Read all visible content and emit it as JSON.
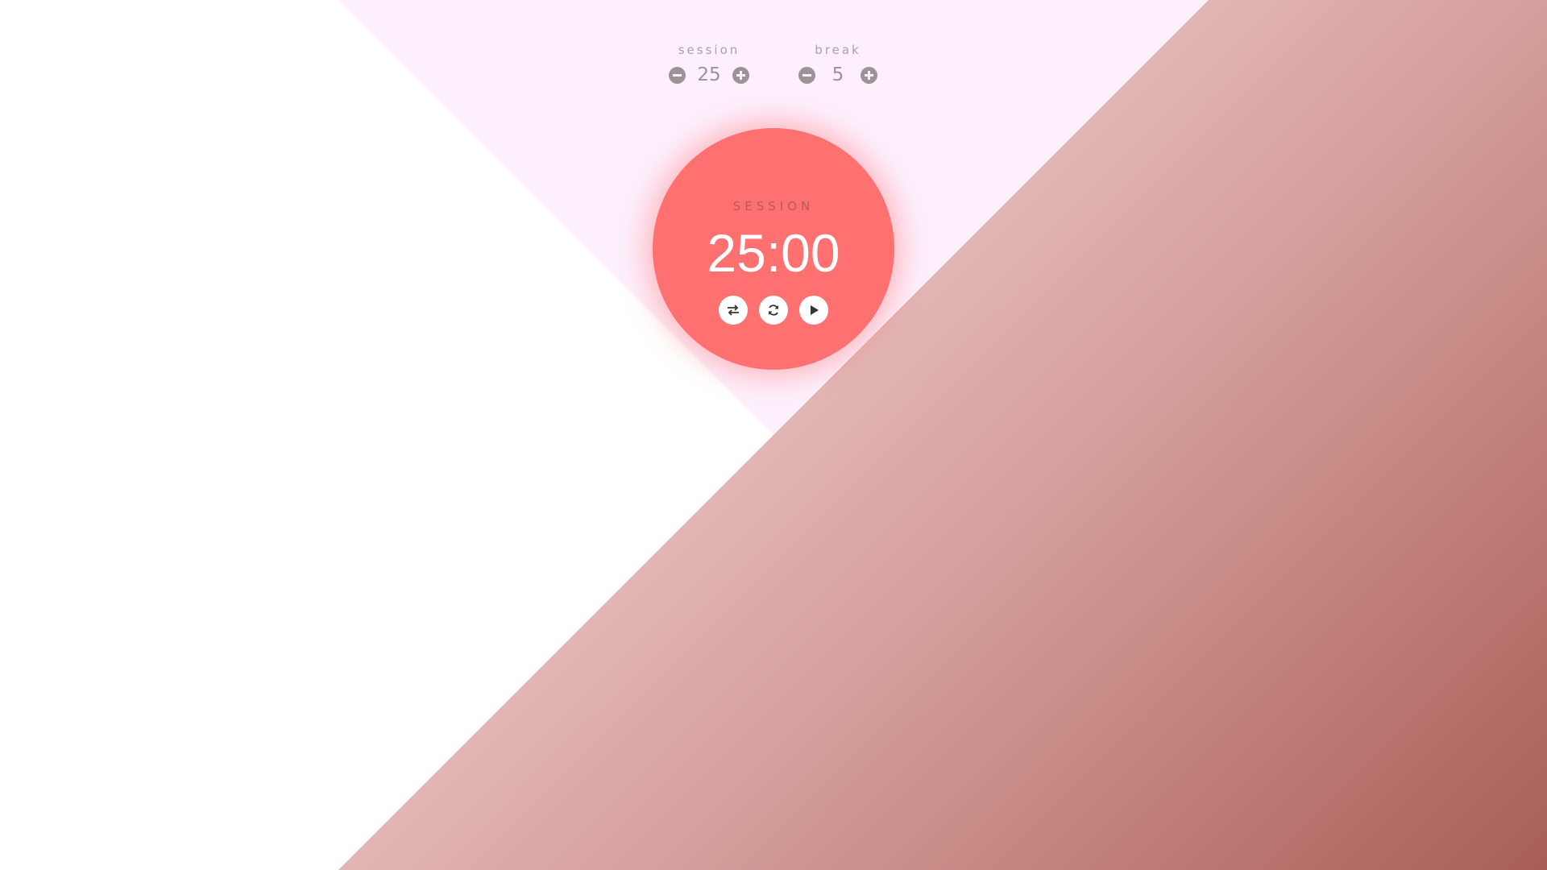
{
  "settings": {
    "session": {
      "label": "session",
      "value": "25"
    },
    "break": {
      "label": "break",
      "value": "5"
    }
  },
  "clock": {
    "mode": "SESSION",
    "time": "25:00",
    "controls": [
      {
        "icon": "swap-icon"
      },
      {
        "icon": "refresh-icon"
      },
      {
        "icon": "play-icon"
      }
    ]
  },
  "colors": {
    "clock_face": "#ff7171",
    "pink_background": "#fdeffc",
    "gradient_start": "#f3dbd9",
    "gradient_end": "#a85e56",
    "control_gray": "#9b9397"
  }
}
